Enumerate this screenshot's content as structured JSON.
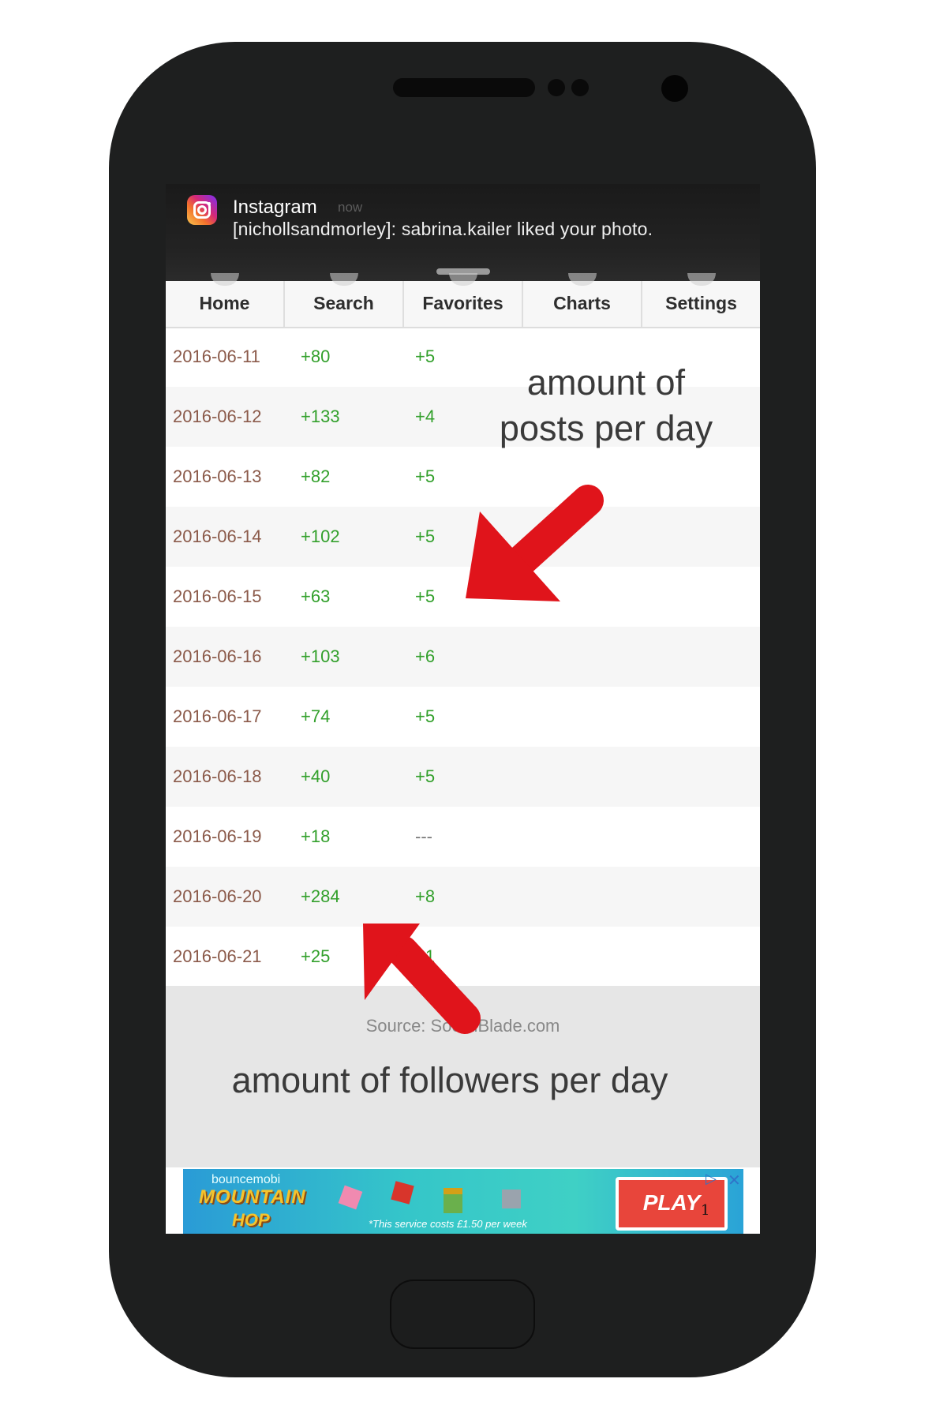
{
  "notification": {
    "app": "Instagram",
    "time": "now",
    "message": "[nichollsandmorley]: sabrina.kailer liked your photo."
  },
  "tabs": [
    "Home",
    "Search",
    "Favorites",
    "Charts",
    "Settings"
  ],
  "rows": [
    {
      "date": "2016-06-11",
      "followers": "+80",
      "posts": "+5"
    },
    {
      "date": "2016-06-12",
      "followers": "+133",
      "posts": "+4"
    },
    {
      "date": "2016-06-13",
      "followers": "+82",
      "posts": "+5"
    },
    {
      "date": "2016-06-14",
      "followers": "+102",
      "posts": "+5"
    },
    {
      "date": "2016-06-15",
      "followers": "+63",
      "posts": "+5"
    },
    {
      "date": "2016-06-16",
      "followers": "+103",
      "posts": "+6"
    },
    {
      "date": "2016-06-17",
      "followers": "+74",
      "posts": "+5"
    },
    {
      "date": "2016-06-18",
      "followers": "+40",
      "posts": "+5"
    },
    {
      "date": "2016-06-19",
      "followers": "+18",
      "posts": "---"
    },
    {
      "date": "2016-06-20",
      "followers": "+284",
      "posts": "+8"
    },
    {
      "date": "2016-06-21",
      "followers": "+25",
      "posts": "+1"
    }
  ],
  "source": "Source: SocialBlade.com",
  "ad": {
    "brand": "bouncemobi",
    "title_line1": "MOUNTAIN",
    "title_line2": "HOP",
    "note": "*This service costs £1.50 per week",
    "button": "PLAY",
    "badge": "1"
  },
  "annotations": {
    "posts_line1": "amount of",
    "posts_line2": "posts per day",
    "followers": "amount of followers per day"
  },
  "colors": {
    "phone_body": "#1e1f1f",
    "positive_value": "#33a02c",
    "date_text": "#8b5a4a",
    "arrow": "#e0141b"
  }
}
